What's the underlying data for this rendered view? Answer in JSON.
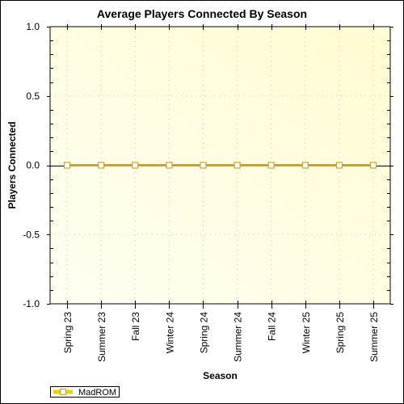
{
  "chart_data": {
    "type": "line",
    "title": "Average Players Connected By Season",
    "xlabel": "Season",
    "ylabel": "Players Connected",
    "categories": [
      "Spring 23",
      "Summer 23",
      "Fall 23",
      "Winter 24",
      "Spring 24",
      "Summer 24",
      "Fall 24",
      "Winter 25",
      "Spring 25",
      "Summer 25"
    ],
    "series": [
      {
        "name": "MadROM",
        "values": [
          0,
          0,
          0,
          0,
          0,
          0,
          0,
          0,
          0,
          0
        ],
        "color": "#d4a020",
        "marker": "open-square"
      }
    ],
    "ylim": [
      -1.0,
      1.0
    ],
    "yticks": [
      "1.0",
      "0.5",
      "0.0",
      "-0.5",
      "-1.0"
    ],
    "ytick_values": [
      1.0,
      0.5,
      0.0,
      -0.5,
      -1.0
    ],
    "grid": true,
    "legend_position": "bottom-left",
    "plot_background": "#fffee6"
  }
}
